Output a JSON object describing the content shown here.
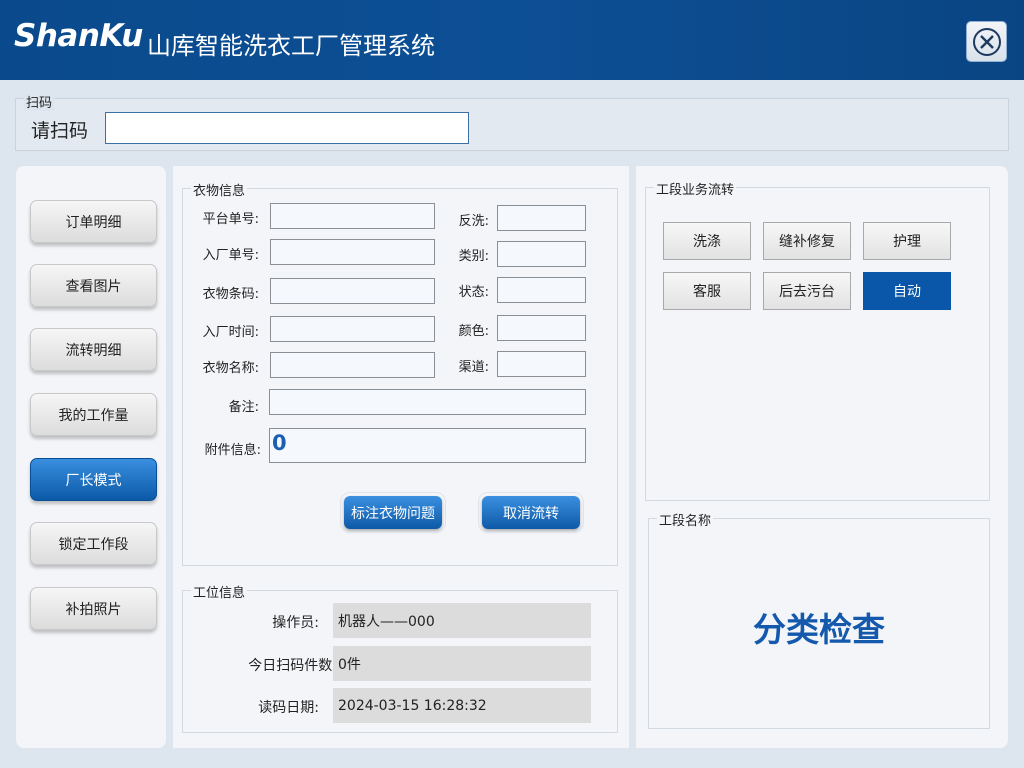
{
  "header": {
    "logo_text": "ShanKu",
    "app_title": "山库智能洗衣工厂管理系统",
    "close_icon": "close-circle-icon"
  },
  "scan": {
    "legend": "扫码",
    "label": "请扫码",
    "value": ""
  },
  "sidebar": {
    "items": [
      {
        "label": "订单明细",
        "active": false
      },
      {
        "label": "查看图片",
        "active": false
      },
      {
        "label": "流转明细",
        "active": false
      },
      {
        "label": "我的工作量",
        "active": false
      },
      {
        "label": "厂长模式",
        "active": true
      },
      {
        "label": "锁定工作段",
        "active": false
      },
      {
        "label": "补拍照片",
        "active": false
      }
    ]
  },
  "clothing": {
    "legend": "衣物信息",
    "platform_order_label": "平台单号:",
    "platform_order_value": "",
    "rewash_label": "反洗:",
    "rewash_value": "",
    "factory_order_label": "入厂单号:",
    "factory_order_value": "",
    "category_label": "类别:",
    "category_value": "",
    "barcode_label": "衣物条码:",
    "barcode_value": "",
    "status_label": "状态:",
    "status_value": "",
    "entry_time_label": "入厂时间:",
    "entry_time_value": "",
    "color_label": "颜色:",
    "color_value": "",
    "name_label": "衣物名称:",
    "name_value": "",
    "channel_label": "渠道:",
    "channel_value": "",
    "remark_label": "备注:",
    "remark_value": "",
    "attachment_label": "附件信息:",
    "attachment_value": "0",
    "mark_issue_button": "标注衣物问题",
    "cancel_flow_button": "取消流转"
  },
  "station": {
    "legend": "工位信息",
    "operator_label": "操作员:",
    "operator_value": "机器人——000",
    "today_count_label": "今日扫码件数:",
    "today_count_value": "0件",
    "read_date_label": "读码日期:",
    "read_date_value": "2024-03-15 16:28:32"
  },
  "flow": {
    "legend": "工段业务流转",
    "buttons": [
      {
        "label": "洗涤",
        "selected": false
      },
      {
        "label": "缝补修复",
        "selected": false
      },
      {
        "label": "护理",
        "selected": false
      },
      {
        "label": "客服",
        "selected": false
      },
      {
        "label": "后去污台",
        "selected": false
      },
      {
        "label": "自动",
        "selected": true
      }
    ]
  },
  "stage": {
    "legend": "工段名称",
    "name": "分类检查"
  },
  "colors": {
    "title_bar": "#0d4f95",
    "accent": "#0a56a8",
    "stage_text": "#1559ad"
  }
}
